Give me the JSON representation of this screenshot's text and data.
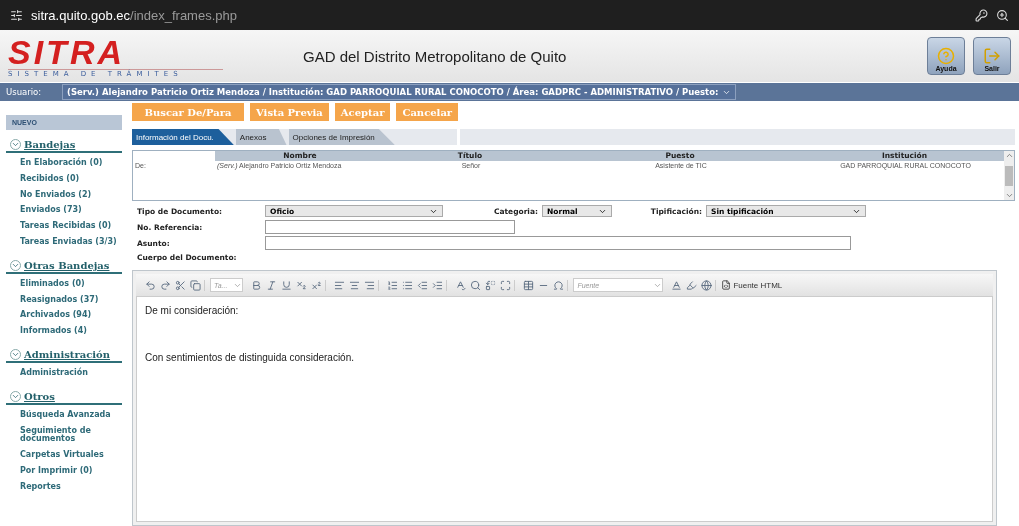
{
  "browser": {
    "url_host": "sitra.quito.gob.ec",
    "url_path": "/index_frames.php"
  },
  "header": {
    "logo_text": "SITRA",
    "logo_subtitle": "SISTEMA DE TRÁMITES",
    "title": "GAD del Distrito Metropolitano de Quito",
    "buttons": [
      {
        "label": "Ayuda",
        "kind": "help"
      },
      {
        "label": "Salir",
        "kind": "exit"
      }
    ]
  },
  "user_bar": {
    "label": "Usuario:",
    "value": "(Serv.) Alejandro Patricio Ortiz Mendoza / Institución: GAD PARROQUIAL RURAL CONOCOTO / Área: GADPRC - ADMINISTRATIVO / Puesto:"
  },
  "sidebar": {
    "new_label": "NUEVO",
    "sections": [
      {
        "title": "Bandejas",
        "expanded": true,
        "items": [
          "En Elaboración (0)",
          "Recibidos (0)",
          "No Enviados (2)",
          "Enviados (73)",
          "Tareas Recibidas (0)",
          "Tareas Enviadas (3/3)"
        ]
      },
      {
        "title": "Otras Bandejas",
        "expanded": true,
        "items": [
          "Eliminados (0)",
          "Reasignados (37)",
          "Archivados (94)",
          "Informados (4)"
        ]
      },
      {
        "title": "Administración",
        "expanded": true,
        "items": [
          "Administración"
        ]
      },
      {
        "title": "Otros",
        "expanded": true,
        "items": [
          "Búsqueda Avanzada",
          "Seguimiento de documentos",
          "Carpetas Virtuales",
          "Por Imprimir (0)",
          "Reportes"
        ]
      }
    ]
  },
  "actions": [
    "Buscar De/Para",
    "Vista Previa",
    "Aceptar",
    "Cancelar"
  ],
  "tabs": [
    {
      "label": "Información del Docu.",
      "selected": true
    },
    {
      "label": "Anexos",
      "selected": false
    },
    {
      "label": "Opciones de Impresión",
      "selected": false
    }
  ],
  "recipients": {
    "columns": [
      "Nombre",
      "Título",
      "Puesto",
      "Institución"
    ],
    "rows": [
      {
        "label": "De:",
        "prefix": "(Serv.)",
        "name": "Alejandro Patricio Ortiz Mendoza",
        "title": "Señor",
        "position": "Asistente de TIC",
        "institution": "GAD PARROQUIAL RURAL CONOCOTO"
      }
    ]
  },
  "form": {
    "doc_type_label": "Tipo de Documento:",
    "doc_type": "Oficio",
    "category_label": "Categoria:",
    "category": "Normal",
    "typing_label": "Tipificación:",
    "typing": "Sin tipificación",
    "reference_label": "No. Referencia:",
    "subject_label": "Asunto:",
    "body_label": "Cuerpo del Documento:"
  },
  "editor": {
    "style_placeholder": "Ta...",
    "font_placeholder": "Fuente",
    "source_label": "Fuente HTML",
    "greeting": "De mi consideración:",
    "closing": "Con sentimientos de distinguida consideración."
  }
}
